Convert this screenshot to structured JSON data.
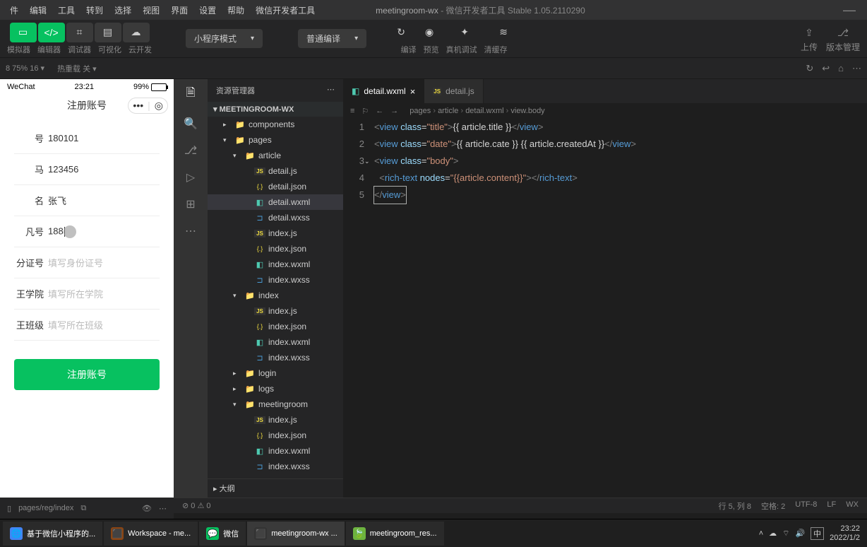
{
  "menu": {
    "items": [
      "件",
      "编辑",
      "工具",
      "转到",
      "选择",
      "视图",
      "界面",
      "设置",
      "帮助",
      "微信开发者工具"
    ]
  },
  "title": {
    "project": "meetingroom-wx",
    "app": "微信开发者工具 Stable 1.05.2110290"
  },
  "toolbar": {
    "mode_labels": [
      "模拟器",
      "编辑器",
      "调试器",
      "可视化",
      "云开发"
    ],
    "mode_select": "小程序模式",
    "compile_select": "普通编译",
    "compile_labels": {
      "compile": "编译",
      "preview": "预览",
      "realdebug": "真机调试",
      "clearcache": "清缓存"
    },
    "right": {
      "upload": "上传",
      "version": "版本管理"
    }
  },
  "secbar": {
    "left": "8 75% 16 ▾",
    "hot": "热重载 关 ▾"
  },
  "simulator": {
    "carrier": "WeChat",
    "time": "23:21",
    "battery": "99%",
    "page_title": "注册账号",
    "rows": [
      {
        "label": "号",
        "value": "180101"
      },
      {
        "label": "马",
        "value": "123456"
      },
      {
        "label": "名",
        "value": "张飞"
      },
      {
        "label": "凡号",
        "value": "188",
        "cursor": true
      },
      {
        "label": "分证号",
        "placeholder": "填写身份证号"
      },
      {
        "label": "王学院",
        "placeholder": "填写所在学院"
      },
      {
        "label": "王班级",
        "placeholder": "填写所在班级"
      }
    ],
    "submit": "注册账号",
    "footer_path": "pages/reg/index"
  },
  "explorer": {
    "header": "资源管理器",
    "project": "MEETINGROOM-WX",
    "tree": [
      {
        "d": 1,
        "t": "folder",
        "arrow": "▸",
        "name": "components"
      },
      {
        "d": 1,
        "t": "folder",
        "arrow": "▾",
        "name": "pages",
        "color": "#c09553"
      },
      {
        "d": 2,
        "t": "folder",
        "arrow": "▾",
        "name": "article"
      },
      {
        "d": 3,
        "t": "js",
        "name": "detail.js"
      },
      {
        "d": 3,
        "t": "json",
        "name": "detail.json"
      },
      {
        "d": 3,
        "t": "wxml",
        "name": "detail.wxml",
        "selected": true
      },
      {
        "d": 3,
        "t": "wxss",
        "name": "detail.wxss"
      },
      {
        "d": 3,
        "t": "js",
        "name": "index.js"
      },
      {
        "d": 3,
        "t": "json",
        "name": "index.json"
      },
      {
        "d": 3,
        "t": "wxml",
        "name": "index.wxml"
      },
      {
        "d": 3,
        "t": "wxss",
        "name": "index.wxss"
      },
      {
        "d": 2,
        "t": "folder",
        "arrow": "▾",
        "name": "index"
      },
      {
        "d": 3,
        "t": "js",
        "name": "index.js"
      },
      {
        "d": 3,
        "t": "json",
        "name": "index.json"
      },
      {
        "d": 3,
        "t": "wxml",
        "name": "index.wxml"
      },
      {
        "d": 3,
        "t": "wxss",
        "name": "index.wxss"
      },
      {
        "d": 2,
        "t": "folder",
        "arrow": "▸",
        "name": "login"
      },
      {
        "d": 2,
        "t": "folder",
        "arrow": "▸",
        "name": "logs"
      },
      {
        "d": 2,
        "t": "folder",
        "arrow": "▾",
        "name": "meetingroom"
      },
      {
        "d": 3,
        "t": "js",
        "name": "index.js"
      },
      {
        "d": 3,
        "t": "json",
        "name": "index.json"
      },
      {
        "d": 3,
        "t": "wxml",
        "name": "index.wxml"
      },
      {
        "d": 3,
        "t": "wxss",
        "name": "index.wxss"
      }
    ],
    "outline": "大纲"
  },
  "tabs": [
    {
      "icon": "wxml",
      "name": "detail.wxml",
      "active": true
    },
    {
      "icon": "js",
      "name": "detail.js"
    }
  ],
  "breadcrumb": [
    "pages",
    "article",
    "detail.wxml",
    "view.body"
  ],
  "code_lines": [
    "1",
    "2",
    "3",
    "4",
    "5"
  ],
  "statusbar": {
    "errors": "⊘ 0 ⚠ 0",
    "pos": "行 5, 列 8",
    "spaces": "空格: 2",
    "enc": "UTF-8",
    "eol": "LF",
    "lang": "WX"
  },
  "taskbar": {
    "tasks": [
      {
        "icon": "🌐",
        "label": "基于微信小程序的...",
        "bg": "#4285f4"
      },
      {
        "icon": "⬛",
        "label": "Workspace - me...",
        "bg": "#8b4513"
      },
      {
        "icon": "💬",
        "label": "微信",
        "bg": "#07c160"
      },
      {
        "icon": "⬛",
        "label": "meetingroom-wx ...",
        "active": true,
        "bg": "#333"
      },
      {
        "icon": "🍃",
        "label": "meetingroom_res...",
        "bg": "#6db33f"
      }
    ],
    "tray": {
      "ime": "中",
      "time": "23:22",
      "date": "2022/1/2"
    }
  }
}
